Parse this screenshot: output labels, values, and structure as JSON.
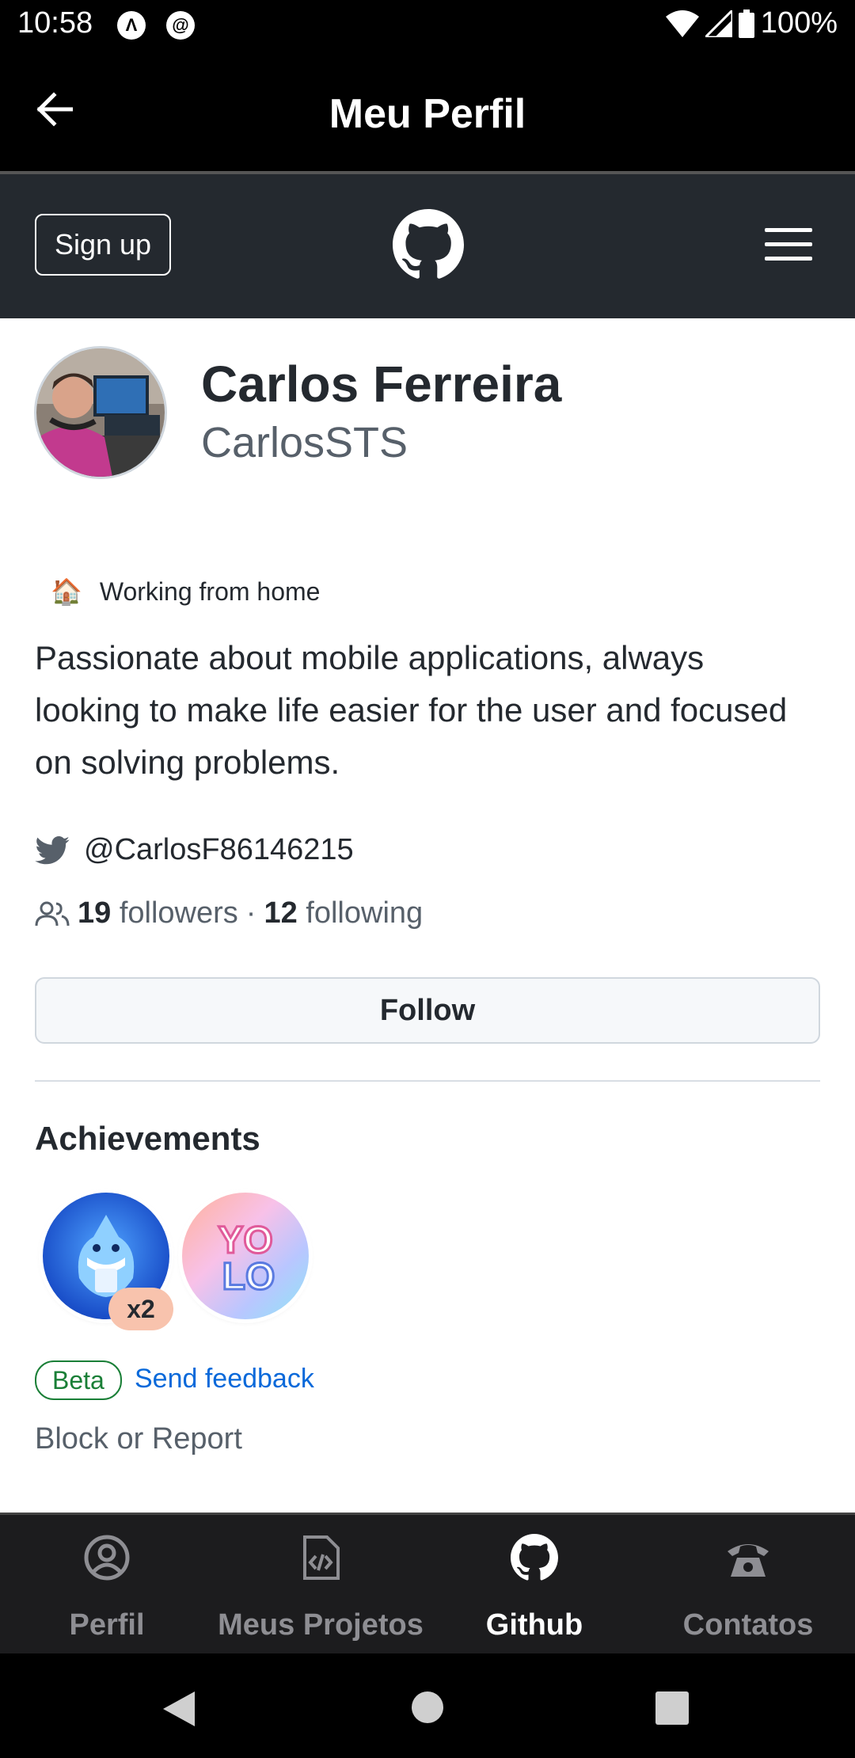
{
  "status_bar": {
    "time": "10:58",
    "battery": "100%"
  },
  "app_bar": {
    "title": "Meu Perfil"
  },
  "github_header": {
    "signup_label": "Sign up"
  },
  "profile": {
    "name": "Carlos Ferreira",
    "login": "CarlosSTS",
    "status_emoji": "🏠",
    "status_text": "Working from home",
    "bio": "Passionate about mobile applications, always looking to make life easier for the user and focused on solving problems.",
    "twitter": "@CarlosF86146215",
    "followers_count": "19",
    "followers_label": "followers",
    "separator": "·",
    "following_count": "12",
    "following_label": "following",
    "follow_button": "Follow"
  },
  "achievements": {
    "title": "Achievements",
    "badges": [
      {
        "icon": "pull-shark-badge-icon",
        "count": "x2"
      },
      {
        "icon": "yolo-badge-icon"
      }
    ],
    "beta_label": "Beta",
    "feedback_label": "Send feedback",
    "block_label": "Block or Report"
  },
  "bottom_nav": {
    "items": [
      {
        "label": "Perfil",
        "icon": "user-circle-icon",
        "active": false
      },
      {
        "label": "Meus Projetos",
        "icon": "code-file-icon",
        "active": false
      },
      {
        "label": "Github",
        "icon": "github-icon",
        "active": true
      },
      {
        "label": "Contatos",
        "icon": "phone-icon",
        "active": false
      }
    ]
  },
  "colors": {
    "header_bg": "#24292f",
    "link": "#0969da",
    "beta_green": "#1a7f37"
  }
}
